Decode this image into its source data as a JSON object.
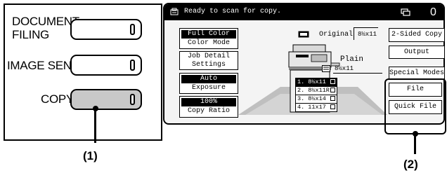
{
  "control_panel": {
    "keys": [
      {
        "label_lines": [
          "DOCUMENT",
          "FILING"
        ],
        "pressed": false
      },
      {
        "label_lines": [
          "IMAGE SEND"
        ],
        "pressed": false
      },
      {
        "label_lines": [
          "COPY"
        ],
        "pressed": true
      }
    ],
    "callout": "(1)"
  },
  "touch_screen": {
    "status": "Ready to scan for copy.",
    "job_count": "0",
    "left_buttons": {
      "color_mode": {
        "value": "Full Color",
        "label": "Color Mode"
      },
      "job_detail": {
        "line1": "Job Detail",
        "line2": "Settings"
      },
      "exposure": {
        "value": "Auto",
        "label": "Exposure"
      },
      "copy_ratio": {
        "value": "100%",
        "label": "Copy Ratio"
      }
    },
    "original": {
      "label": "Original",
      "size": "8½x11"
    },
    "paper": {
      "type": "Plain",
      "size": "8½x11"
    },
    "trays": [
      {
        "label": "1. 8½x11",
        "selected": true
      },
      {
        "label": "2. 8½x11R",
        "selected": false
      },
      {
        "label": "3. 8½x14",
        "selected": false
      },
      {
        "label": "4. 11x17",
        "selected": false
      }
    ],
    "right_buttons": {
      "two_sided": "2-Sided Copy",
      "output": "Output",
      "special_modes": "Special Modes",
      "file": "File",
      "quick_file": "Quick File"
    },
    "callout": "(2)"
  }
}
